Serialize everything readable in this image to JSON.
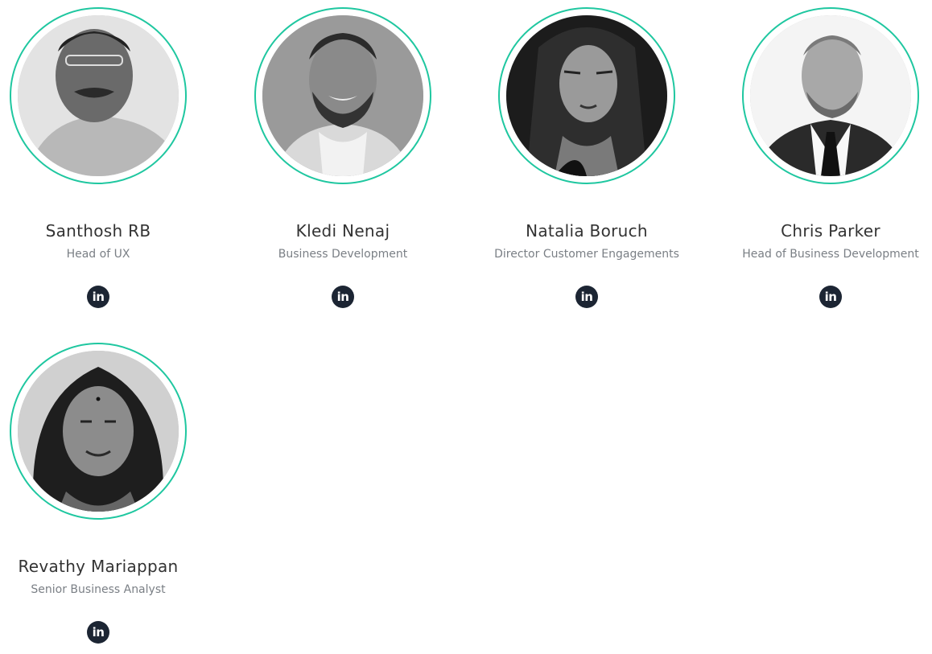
{
  "team": {
    "accent_color": "#1fc7a0",
    "members": [
      {
        "name": "Santhosh RB",
        "role": "Head of UX",
        "social_icon": "linkedin-icon",
        "social_glyph": "in"
      },
      {
        "name": "Kledi Nenaj",
        "role": "Business Development",
        "social_icon": "linkedin-icon",
        "social_glyph": "in"
      },
      {
        "name": "Natalia Boruch",
        "role": "Director Customer Engagements",
        "social_icon": "linkedin-icon",
        "social_glyph": "in"
      },
      {
        "name": "Chris Parker",
        "role": "Head of Business Development",
        "social_icon": "linkedin-icon",
        "social_glyph": "in"
      },
      {
        "name": "Revathy Mariappan",
        "role": "Senior Business Analyst",
        "social_icon": "linkedin-icon",
        "social_glyph": "in"
      }
    ]
  }
}
